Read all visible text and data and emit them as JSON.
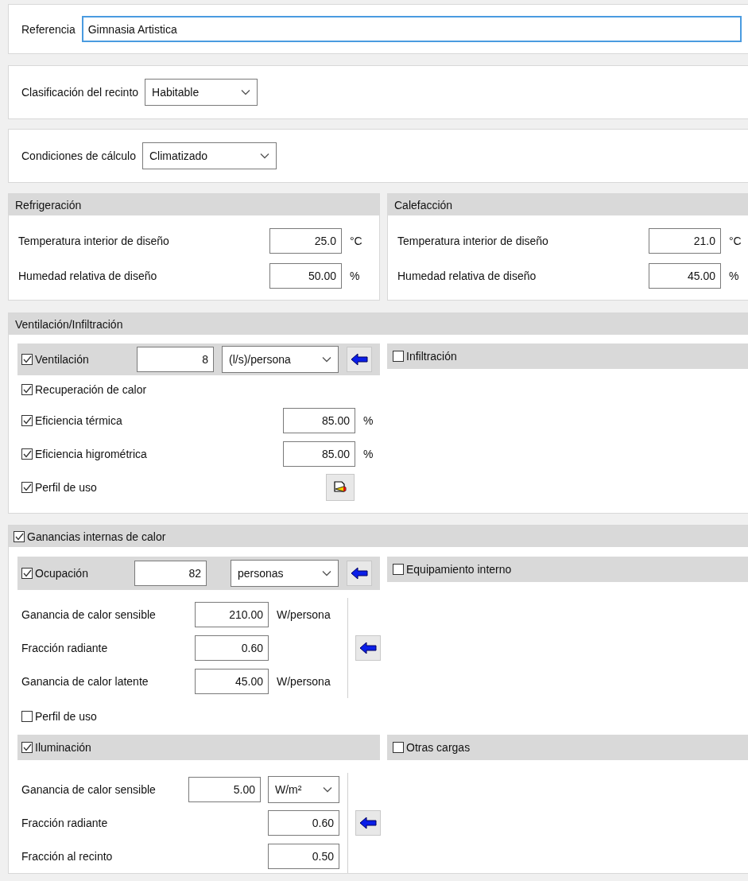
{
  "reference": {
    "label": "Referencia",
    "value": "Gimnasia Artistica"
  },
  "classification": {
    "label": "Clasificación del recinto",
    "value": "Habitable"
  },
  "conditions": {
    "label": "Condiciones de cálculo",
    "value": "Climatizado"
  },
  "design_panels": [
    {
      "title": "Refrigeración",
      "fields": [
        {
          "label": "Temperatura interior de diseño",
          "value": "25.0",
          "unit": "°C"
        },
        {
          "label": "Humedad relativa de diseño",
          "value": "50.00",
          "unit": "%"
        }
      ]
    },
    {
      "title": "Calefacción",
      "fields": [
        {
          "label": "Temperatura interior de diseño",
          "value": "21.0",
          "unit": "°C"
        },
        {
          "label": "Humedad relativa de diseño",
          "value": "45.00",
          "unit": "%"
        }
      ]
    }
  ],
  "ventilation": {
    "title": "Ventilación/Infiltración",
    "main": {
      "label": "Ventilación",
      "checked": true,
      "value": "8",
      "unit": "(l/s)/persona"
    },
    "side": {
      "label": "Infiltración",
      "checked": false
    },
    "options": [
      {
        "kind": "check",
        "label": "Recuperación de calor",
        "checked": true
      },
      {
        "kind": "field",
        "label": "Eficiencia térmica",
        "checked": true,
        "value": "85.00",
        "unit": "%"
      },
      {
        "kind": "field",
        "label": "Eficiencia higrométrica",
        "checked": true,
        "value": "85.00",
        "unit": "%"
      },
      {
        "kind": "profile",
        "label": "Perfil de uso",
        "checked": true
      }
    ]
  },
  "gains": {
    "title": "Ganancias internas de calor",
    "checked": true,
    "occupancy": {
      "main": {
        "label": "Ocupación",
        "checked": true,
        "value": "82",
        "unit": "personas"
      },
      "side": {
        "label": "Equipamiento interno",
        "checked": false
      },
      "fields": [
        {
          "kind": "input",
          "label": "Ganancia de calor sensible",
          "value": "210.00",
          "unit": "W/persona"
        },
        {
          "kind": "input",
          "label": "Fracción radiante",
          "value": "0.60"
        },
        {
          "kind": "input",
          "label": "Ganancia de calor latente",
          "value": "45.00",
          "unit": "W/persona"
        }
      ],
      "profile": {
        "label": "Perfil de uso",
        "checked": false
      }
    },
    "lighting": {
      "main": {
        "label": "Iluminación",
        "checked": true
      },
      "side": {
        "label": "Otras cargas",
        "checked": false
      },
      "fields": [
        {
          "kind": "input_select",
          "label": "Ganancia de calor sensible",
          "value": "5.00",
          "unit": "W/m²"
        },
        {
          "kind": "right",
          "label": "Fracción radiante",
          "value": "0.60"
        },
        {
          "kind": "right",
          "label": "Fracción al recinto",
          "value": "0.50"
        }
      ]
    }
  }
}
